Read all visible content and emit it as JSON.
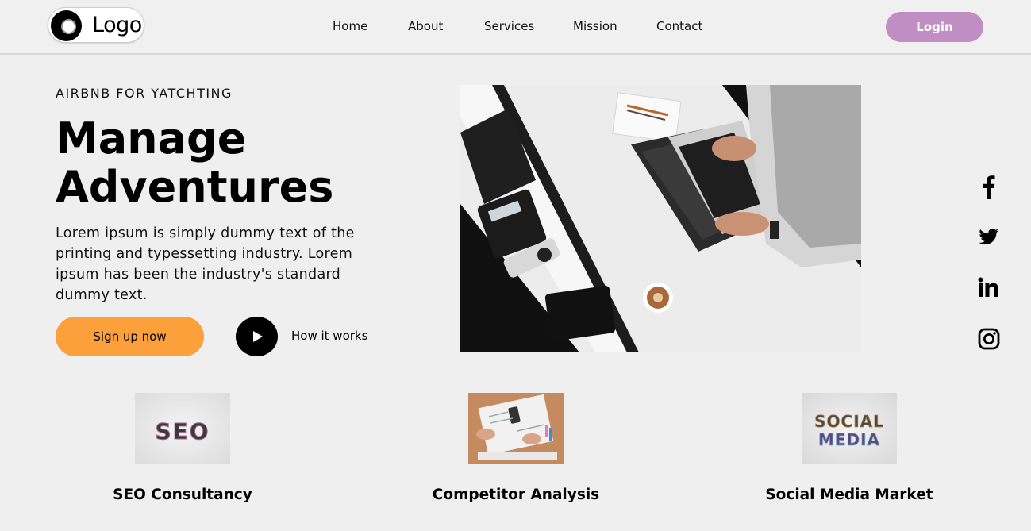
{
  "header": {
    "logo_text": "Logo",
    "nav": [
      "Home",
      "About",
      "Services",
      "Mission",
      "Contact"
    ],
    "login_label": "Login"
  },
  "hero": {
    "eyebrow": "AIRBNB FOR YATCHTING",
    "title_line1": "Manage",
    "title_line2": "Adventures",
    "description": "Lorem ipsum is simply dummy text of the printing and typessetting industry. Lorem ipsum has been the industry's standard dummy text.",
    "cta_label": "Sign up now",
    "how_label": "How it works"
  },
  "social": [
    "facebook-icon",
    "twitter-icon",
    "linkedin-icon",
    "instagram-icon"
  ],
  "services": [
    {
      "title": "SEO Consultancy",
      "image_text": "SEO"
    },
    {
      "title": "Competitor Analysis"
    },
    {
      "title": "Social Media Market",
      "image_text_line1": "SOCIAL",
      "image_text_line2": "MEDIA"
    }
  ],
  "colors": {
    "background": "#efefef",
    "login": "#c18ec4",
    "cta": "#fba03b"
  }
}
